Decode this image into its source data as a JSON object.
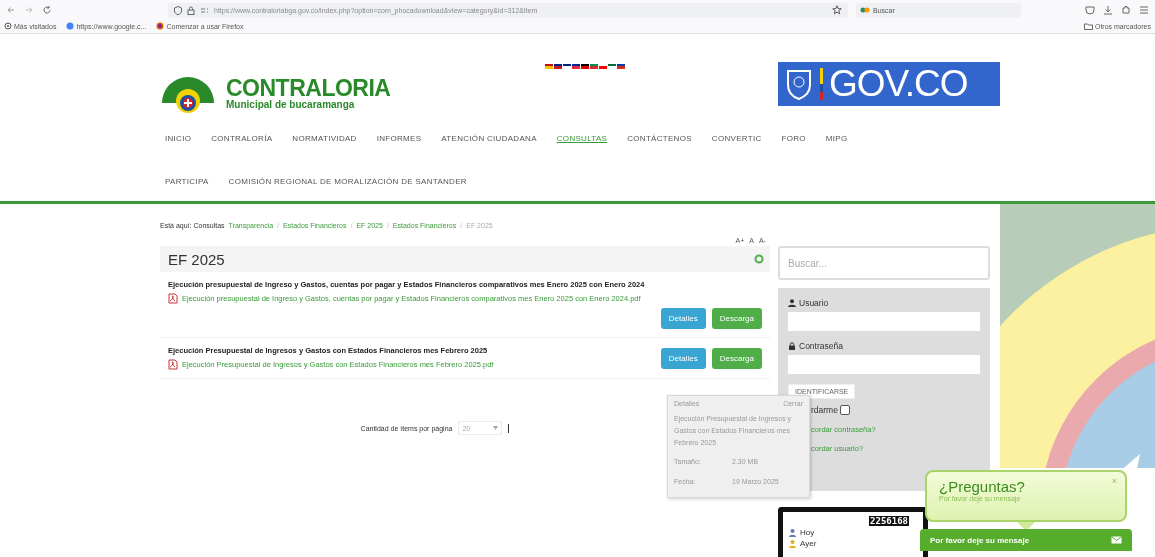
{
  "browser": {
    "url": "https://www.contraloriabga.gov.co/index.php?option=com_phocadownload&view=category&id=312&Item",
    "search": {
      "placeholder": "Buscar"
    },
    "bookmarks": [
      "Más visitados",
      "https://www.google.c...",
      "Comenzar a usar Firefox"
    ],
    "other_bookmarks": "Otros marcadores"
  },
  "header": {
    "logo_title": "CONTRALORIA",
    "logo_subtitle": "Municipal de bucaramanga",
    "gov_logo": "GOV.CO"
  },
  "nav": {
    "rows": [
      {
        "items": [
          {
            "label": "INICIO",
            "selected": false
          },
          {
            "label": "CONTRALORÍA",
            "selected": false
          },
          {
            "label": "NORMATIVIDAD",
            "selected": false
          },
          {
            "label": "INFORMES",
            "selected": false
          },
          {
            "label": "ATENCIÓN CIUDADANA",
            "selected": false
          },
          {
            "label": "CONSULTAS",
            "selected": true
          },
          {
            "label": "CONTÁCTENOS",
            "selected": false
          },
          {
            "label": "CONVERTIC",
            "selected": false
          },
          {
            "label": "FORO",
            "selected": false
          },
          {
            "label": "MIPG",
            "selected": false
          }
        ]
      },
      {
        "items": [
          {
            "label": "PARTICIPA",
            "selected": false
          },
          {
            "label": "COMISIÓN REGIONAL DE MORALIZACIÓN DE SANTANDER",
            "selected": false
          }
        ]
      }
    ]
  },
  "breadcrumb": {
    "label": "Está aquí: Consultas",
    "separators": [
      "/",
      "/",
      "/",
      "/"
    ],
    "items": [
      {
        "label": "Transparencia",
        "current": false
      },
      {
        "label": "Estados Financieros",
        "current": false
      },
      {
        "label": "EF 2025",
        "current": false
      },
      {
        "label": "Estados Financieros",
        "current": false
      },
      {
        "label": "EF 2025",
        "current": true
      }
    ]
  },
  "font_size_controls": [
    "A+",
    "A",
    "A-"
  ],
  "category": {
    "title": "EF 2025"
  },
  "files": [
    {
      "title": "Ejecución presupuestal de Ingreso y Gastos, cuentas por pagar y Estados Financieros comparativos mes Enero 2025 con Enero 2024",
      "file": "Ejecución presupuestal de Ingreso y Gastos, cuentas por pagar y Estados Financieros comparativos mes Enero 2025 con Enero 2024.pdf",
      "buttons": [
        "Detalles",
        "Descarga"
      ]
    },
    {
      "title": "Ejecución Presupuestal de Ingresos y Gastos con Estados Financieros mes Febrero 2025",
      "file": "Ejecución Presupuestal de Ingresos y Gastos con Estados Financieros mes Febrero 2025.pdf",
      "buttons": [
        "Detalles",
        "Descarga"
      ]
    }
  ],
  "pagination": {
    "label": "Cantidad de ítems por página",
    "value": "20"
  },
  "search": {
    "placeholder": "Buscar..."
  },
  "login": {
    "username_label": "Usuario",
    "password_label": "Contraseña",
    "submit": "IDENTIFICARSE",
    "remember": {
      "label": "rdarme",
      "checked": false
    },
    "links": [
      "cordar contraseña?",
      "cordar usuario?"
    ]
  },
  "details_popup": {
    "title": "Detalles",
    "close": "Cerrar",
    "description": "Ejecución Presupuestal de Ingresos y Gastos con Estados Financieros mes Febrero 2025",
    "fields": [
      {
        "label": "Tamaño:",
        "value": "2.30 MB"
      },
      {
        "label": "Fecha:",
        "value": "19 Marzo 2025"
      }
    ]
  },
  "counter": {
    "digits": "2256168",
    "rows": [
      "Hoy",
      "Ayer"
    ]
  },
  "chat": {
    "title": "¿Preguntas?",
    "subtitle": "Por favor deje su mensaje",
    "close": "×",
    "bar": "Por favor deje su mensaje"
  }
}
